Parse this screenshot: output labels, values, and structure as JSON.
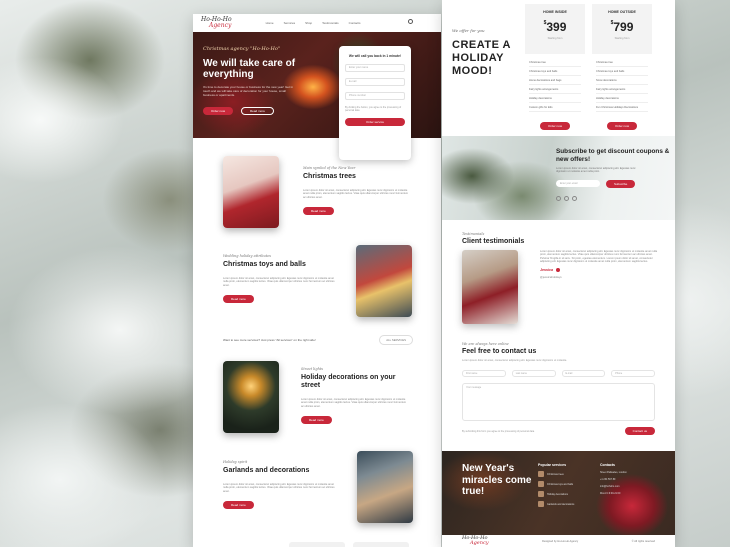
{
  "brand": {
    "name": "Ho-Ho-Ho",
    "sub": "Agency"
  },
  "nav": {
    "links": [
      "Home",
      "Services",
      "Shop",
      "Testimonials",
      "Contacts"
    ]
  },
  "hero": {
    "kicker": "Christmas agency \"Ho-Ho-Ho\"",
    "title": "We will take care of everything",
    "text": "It's time to decorate your house or business for the new year! Get in touch and we will take care of decoration for your house, small business or apartments.",
    "primary": "Order now",
    "secondary": "Read more"
  },
  "form": {
    "title": "We will call you back in 1 minute!",
    "name": "Enter your name",
    "email": "E-mail",
    "phone": "Phone number",
    "note": "By clicking the button, you agree to the processing of personal data",
    "button": "Order service"
  },
  "features": [
    {
      "kicker": "Main symbol of the New Year",
      "title": "Christmas trees",
      "text": "Lorem ipsum dolor sit amet, consectetur adipiscing elit. Egestas nunc dignissim ut molestie amet nulla proin, elementum sagittis lectus. Vitae quis ullamcorper ultricies nunc fermentum ac ultricies amet.",
      "button": "Read more"
    },
    {
      "kicker": "Wedding holiday attributes",
      "title": "Christmas toys and balls",
      "text": "Lorem ipsum dolor sit amet, consectetur adipiscing elit. Egestas nunc dignissim ut molestie amet nulla proin, elementum sagittis lectus. Vitae quis ullamcorper ultricies nunc fermentum ac ultricies amet.",
      "button": "Read more"
    },
    {
      "kicker": "Street lights",
      "title": "Holiday decorations on your street",
      "text": "Lorem ipsum dolor sit amet, consectetur adipiscing elit. Egestas nunc dignissim ut molestie amet nulla proin, elementum sagittis lectus. Vitae quis ullamcorper ultricies nunc fermentum ac ultricies amet.",
      "button": "Read more"
    },
    {
      "kicker": "Holiday spirit",
      "title": "Garlands and decorations",
      "text": "Lorem ipsum dolor sit amet, consectetur adipiscing elit. Egestas nunc dignissim ut molestie amet nulla proin, elementum sagittis lectus. Vitae quis ullamcorper ultricies nunc fermentum ac ultricies amet.",
      "button": "Read more"
    }
  ],
  "cta": {
    "text": "Want to see more services? Just press \"All services\" on the right side!",
    "button": "ALL SERVICES"
  },
  "pricing": {
    "kicker": "We offer for you",
    "title": "CREATE A HOLIDAY MOOD!",
    "plans": [
      {
        "name": "HOME INSIDE",
        "price": "399",
        "currency": "$",
        "per": "Starting from",
        "items": [
          "Christmas tree",
          "Christmas toys and balls",
          "Home decorations and bags",
          "Fairy lights arrangements",
          "Holiday decorations",
          "Custom gifts for kids"
        ],
        "button": "Order now"
      },
      {
        "name": "HOME OUTSIDE",
        "price": "799",
        "currency": "$",
        "per": "Starting from",
        "items": [
          "Christmas tree",
          "Christmas toys and balls",
          "Snow decorations",
          "Fairy lights arrangements",
          "Holiday decorations",
          "Fun Christmas Holidays Decorations"
        ],
        "button": "Order now"
      }
    ]
  },
  "subscribe": {
    "title": "Subscribe to get discount coupons & new offers!",
    "text": "Lorem ipsum dolor sit amet, consectetur adipiscing elit. Egestas nunc dignissim ut molestie amet nulla proin.",
    "placeholder": "Enter your email",
    "button": "Subscribe"
  },
  "testimonials": {
    "kicker": "Testimonials",
    "title": "Client testimonials",
    "text": "Lorem ipsum dolor sit amet, consectetur adipiscing elit. Egestas nunc dignissim ut molestie amet nulla proin, elementum sagittis lectus. Vitae quis ullamcorper ultricies nunc fermentum ac ultricies amet. Pulvinar fringilla in sit arcu. Sit proin, egestas elementum. Lorem ipsum dolor sit amet, consectetur adipiscing elit. Egestas nunc dignissim ut molestie amet nulla proin, elementum sagittis lectus.",
    "name": "Jessica",
    "handle": "@jessicaholidays"
  },
  "contact": {
    "kicker": "We are always here online",
    "title": "Feel free to contact us",
    "desc": "Lorem ipsum dolor sit amet, consectetur adipiscing elit. Egestas nunc dignissim ut molestie.",
    "fields": [
      "First name",
      "Last name",
      "E-mail",
      "Phone"
    ],
    "message": "Your message",
    "note": "By submitting this form you agree to the processing of personal data",
    "button": "Contact us"
  },
  "footer": {
    "title": "New Year's miracles come true!",
    "col1": {
      "head": "Popular services",
      "items": [
        "Christmas trees",
        "Christmas toys and balls",
        "Holiday decorations",
        "Garlands and decorations"
      ]
    },
    "col2": {
      "head": "Contacts",
      "items": [
        "Street Palisades, London",
        "+1 234 567 89",
        "info@hohoho.com",
        "Mon-Fri 9:00-21:00"
      ]
    },
    "designed": "Designed by Ho-Ho-Ho Agency",
    "copyright": "© All rights reserved"
  }
}
